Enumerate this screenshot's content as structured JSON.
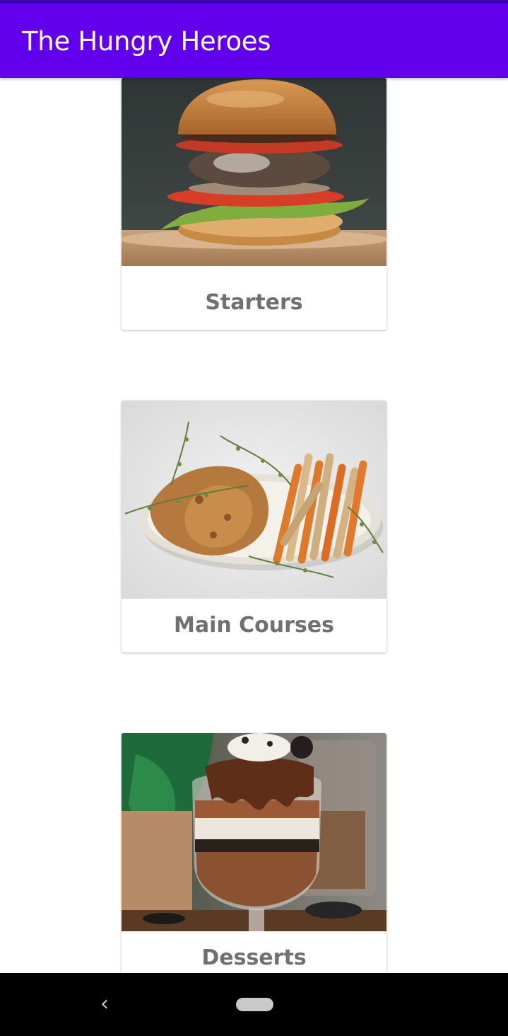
{
  "app": {
    "title": "The Hungry Heroes"
  },
  "categories": [
    {
      "label": "Starters",
      "image": "burger-photo"
    },
    {
      "label": "Main Courses",
      "image": "fried-chicken-and-fries-photo"
    },
    {
      "label": "Desserts",
      "image": "chocolate-parfait-photo"
    }
  ],
  "colors": {
    "app_bar": "#6200ee",
    "status_bar": "#3a00b3",
    "label_text": "#707070",
    "nav_bar": "#000000"
  },
  "navigation": {
    "back_icon": "chevron-left-icon",
    "home_icon": "home-pill-icon"
  }
}
